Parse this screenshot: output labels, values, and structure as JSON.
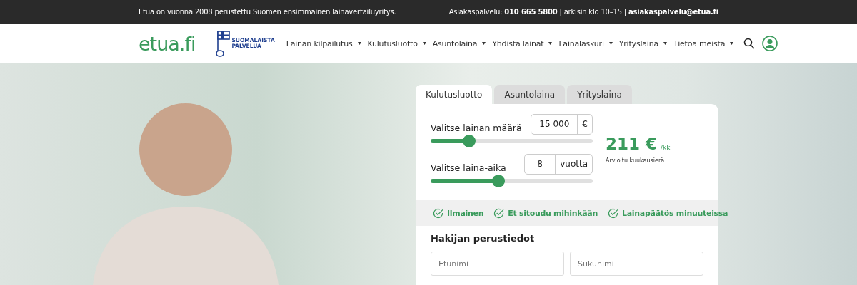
{
  "top_bar": {
    "tagline": "Etua on vuonna 2008 perustettu Suomen ensimmäinen lainavertailuyritys.",
    "contact": "Asiakaspalvelu: **010 665 5800** | arkisin klo 10–15 | **asiakaspalvelu@etua.fi**"
  },
  "header": {
    "logo": "etua.fi",
    "badge_lines": [
      "SUOMALAISTA",
      "PALVELUA"
    ],
    "nav": [
      {
        "label": "Lainan kilpailutus"
      },
      {
        "label": "Kulutusluotto"
      },
      {
        "label": "Asuntolaina"
      },
      {
        "label": "Yhdistä lainat"
      },
      {
        "label": "Lainalaskuri"
      },
      {
        "label": "Yrityslaina"
      },
      {
        "label": "Tietoa meistä"
      }
    ]
  },
  "calculator": {
    "tabs": [
      {
        "label": "Kulutusluotto",
        "selected": true
      },
      {
        "label": "Asuntolaina",
        "selected": false
      },
      {
        "label": "Yrityslaina",
        "selected": false
      }
    ],
    "sliders": [
      {
        "label": "Valitse lainan määrä",
        "value": "15 000",
        "unit": "€",
        "level": 0.24
      },
      {
        "label": "Valitse laina-aika",
        "value": "8",
        "unit": "vuotta",
        "level": 0.42
      }
    ],
    "result": {
      "amount": "211 €",
      "per": "/kk",
      "caption": "Arvioitu kuukausierä"
    },
    "benefits": [
      "Ilmainen",
      "Et sitoudu mihinkään",
      "Lainapäätös minuuteissa"
    ],
    "form_title": "Hakijan perustiedot",
    "fields": [
      {
        "placeholder": "Etunimi"
      },
      {
        "placeholder": "Sukunimi"
      }
    ]
  }
}
